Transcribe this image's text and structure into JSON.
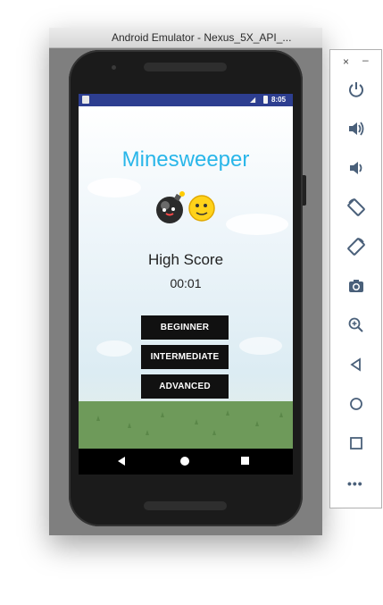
{
  "window": {
    "title": "Android Emulator - Nexus_5X_API_..."
  },
  "statusbar": {
    "time": "8:05"
  },
  "app": {
    "title": "Minesweeper",
    "high_score_label": "High Score",
    "high_score_value": "00:01",
    "buttons": {
      "beginner": "BEGINNER",
      "intermediate": "INTERMEDIATE",
      "advanced": "ADVANCED"
    }
  },
  "navbar": {
    "icons": [
      "back-icon",
      "home-icon",
      "recents-icon"
    ]
  },
  "toolbar": {
    "close": "×",
    "minimize": "–",
    "more": "•••",
    "icons": [
      "power-icon",
      "volume-up-icon",
      "volume-down-icon",
      "rotate-left-icon",
      "rotate-right-icon",
      "camera-icon",
      "zoom-icon",
      "back-icon",
      "home-icon",
      "overview-icon",
      "more-icon"
    ]
  },
  "colors": {
    "title": "#29b6e9",
    "statusbar": "#2d3e90",
    "toolbar_icon": "#4a607a",
    "button_bg": "#111111"
  }
}
